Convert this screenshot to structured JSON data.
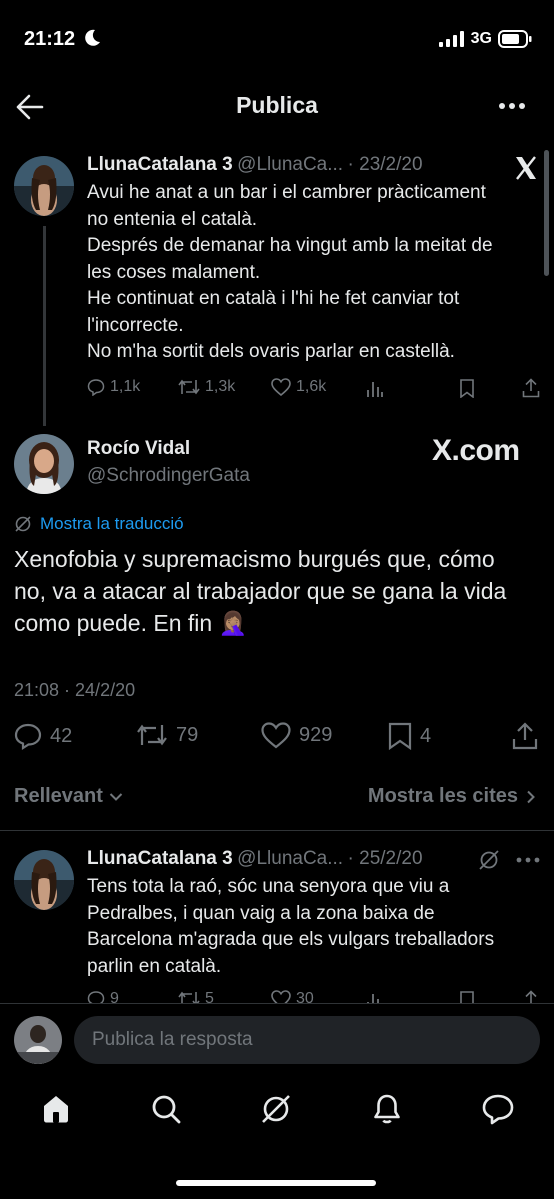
{
  "status_bar": {
    "time": "21:12",
    "network": "3G"
  },
  "header": {
    "title": "Publica"
  },
  "original_tweet": {
    "name": "LlunaCatalana 3",
    "handle": "@LlunaCa...",
    "date": "· 23/2/20",
    "lines": [
      "Avui he anat a un bar i el cambrer pràcticament",
      "no entenia el català.",
      "Després de demanar ha vingut amb la meitat de",
      "les coses malament.",
      "He continuat en català i l'hi he fet canviar tot",
      "l'incorrecte.",
      "No m'ha sortit dels ovaris parlar en castellà."
    ],
    "replies": "1,1k",
    "retweets": "1,3k",
    "likes": "1,6k"
  },
  "main_tweet": {
    "name": "Rocío Vidal",
    "handle": "@SchrodingerGata",
    "watermark": "X.com",
    "translate_label": "Mostra la traducció",
    "lines": [
      "Xenofobia y supremacismo burgués que, cómo",
      "no, va a atacar al trabajador que se gana la vida",
      "como puede. En fin 🤦🏽‍♀️"
    ],
    "timestamp": "21:08 · 24/2/20",
    "replies": "42",
    "retweets": "79",
    "likes": "929",
    "bookmarks": "4"
  },
  "filters": {
    "sort_label": "Rellevant",
    "quotes_label": "Mostra les cites"
  },
  "reply_tweet": {
    "name": "LlunaCatalana 3",
    "handle": "@LlunaCa...",
    "date": "· 25/2/20",
    "lines": [
      "Tens tota la raó, sóc una senyora que viu a",
      "Pedralbes, i quan vaig a la zona baixa de",
      "Barcelona m'agrada que els vulgars treballadors",
      "parlin en català."
    ],
    "replies": "9",
    "retweets": "5",
    "likes": "30"
  },
  "composer": {
    "placeholder": "Publica la resposta"
  },
  "colors": {
    "background": "#000000",
    "text": "#e7e9ea",
    "muted": "#71767b",
    "accent": "#1d9bf0",
    "divider": "#2f3336"
  },
  "icons": [
    "back-arrow-icon",
    "more-icon",
    "x-logo-icon",
    "reply-icon",
    "retweet-icon",
    "like-icon",
    "views-icon",
    "bookmark-icon",
    "share-icon",
    "translate-icon",
    "chevron-down-icon",
    "chevron-right-icon",
    "grok-icon",
    "home-icon",
    "search-icon",
    "notifications-icon",
    "messages-icon"
  ]
}
